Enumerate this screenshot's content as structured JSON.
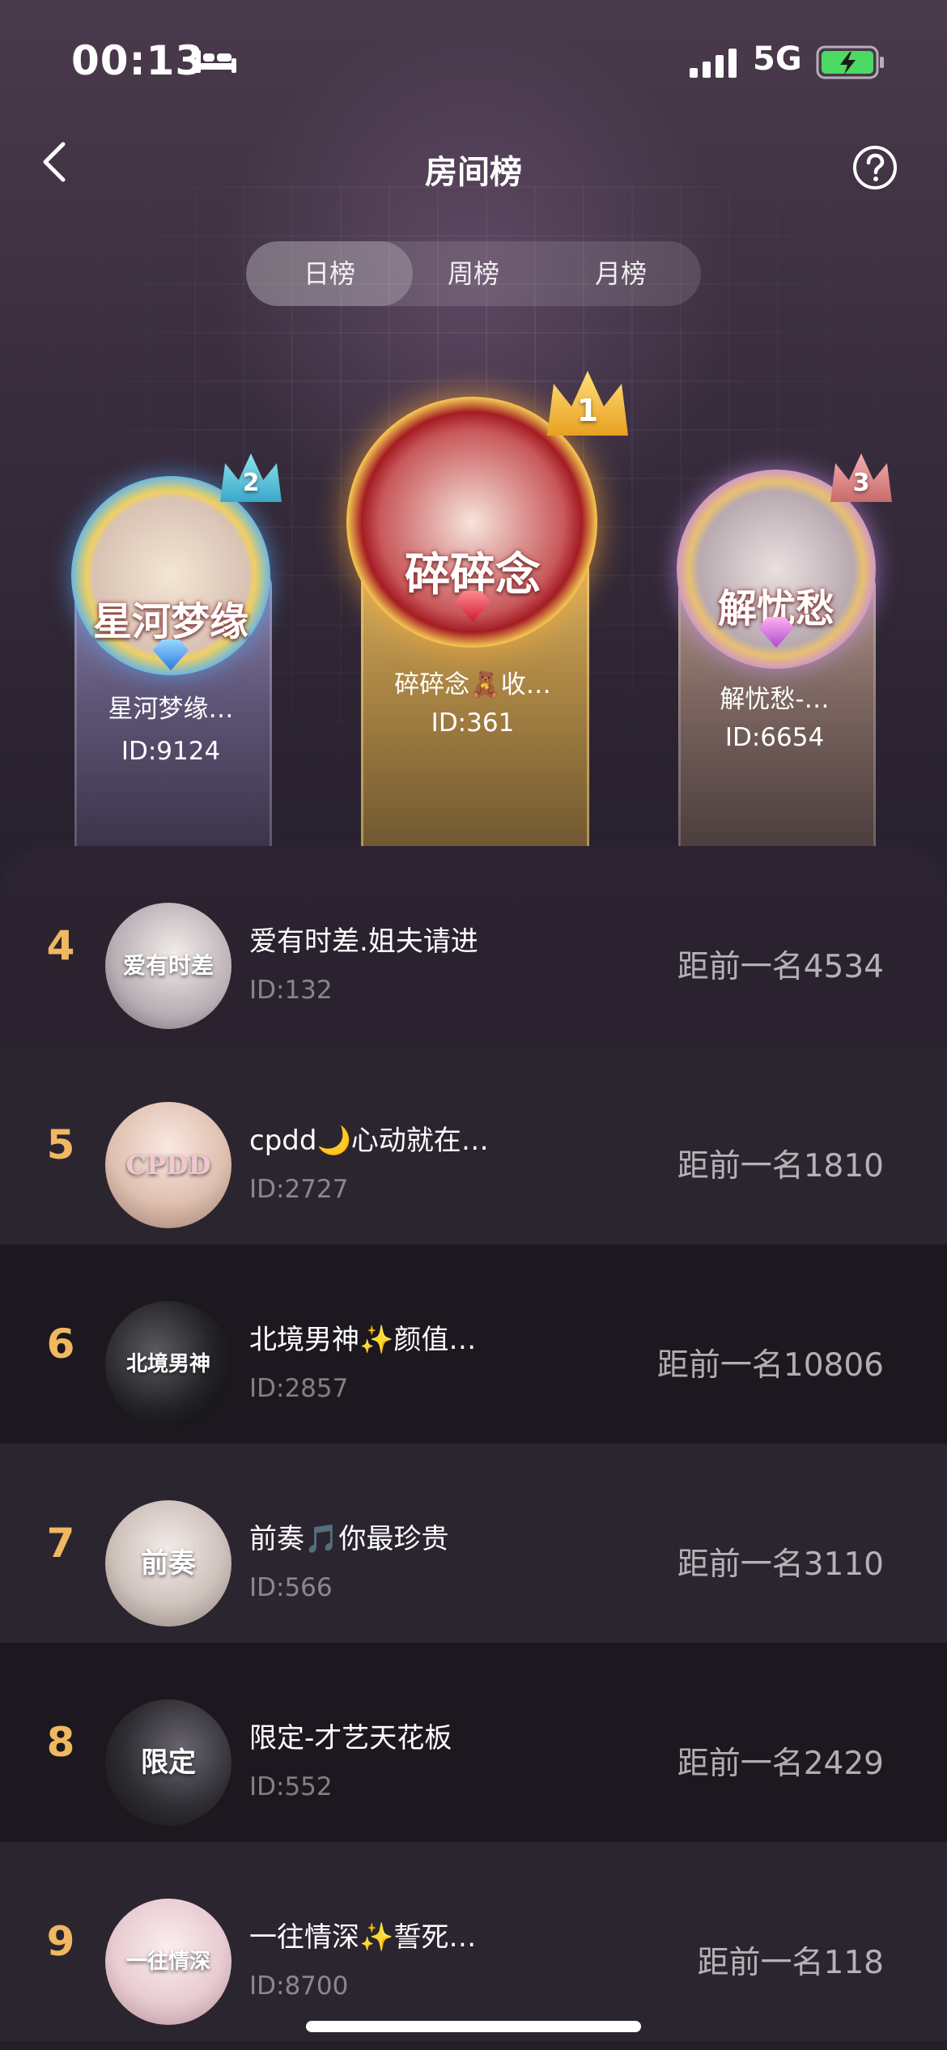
{
  "status_bar": {
    "time": "00:13",
    "network": "5G",
    "icons": [
      "sleep-mode-icon",
      "signal-icon",
      "battery-charging-icon"
    ]
  },
  "header": {
    "title": "房间榜",
    "back_icon": "chevron-left-icon",
    "help_icon": "question-circle-icon"
  },
  "tabs": [
    {
      "label": "日榜",
      "active": true
    },
    {
      "label": "周榜",
      "active": false
    },
    {
      "label": "月榜",
      "active": false
    }
  ],
  "podium": [
    {
      "rank": "1",
      "frame_text": "碎碎念",
      "name": "碎碎念🧸收…",
      "id": "ID:361"
    },
    {
      "rank": "2",
      "frame_text": "星河梦缘",
      "name": "星河梦缘…",
      "id": "ID:9124"
    },
    {
      "rank": "3",
      "frame_text": "解忧愁",
      "name": "解忧愁-…",
      "id": "ID:6654"
    }
  ],
  "list": [
    {
      "rank": "4",
      "avatar_text": "爱有时差",
      "name": "爱有时差.姐夫请进",
      "id": "ID:132",
      "gap": "距前一名4534",
      "avatar_color": "#d8d0d4"
    },
    {
      "rank": "5",
      "avatar_text": "CPDD",
      "name": "cpdd🌙心动就在…",
      "id": "ID:2727",
      "gap": "距前一名1810",
      "avatar_color": "#ead6cc"
    },
    {
      "rank": "6",
      "avatar_text": "北境男神",
      "name": "北境男神✨颜值…",
      "id": "ID:2857",
      "gap": "距前一名10806",
      "avatar_color": "#1e1e22"
    },
    {
      "rank": "7",
      "avatar_text": "前奏",
      "name": "前奏🎵你最珍贵",
      "id": "ID:566",
      "gap": "距前一名3110",
      "avatar_color": "#d6ccc6"
    },
    {
      "rank": "8",
      "avatar_text": "限定",
      "name": "限定-才艺天花板",
      "id": "ID:552",
      "gap": "距前一名2429",
      "avatar_color": "#2a282c"
    },
    {
      "rank": "9",
      "avatar_text": "一往情深",
      "name": "一往情深✨誓死…",
      "id": "ID:8700",
      "gap": "距前一名118",
      "avatar_color": "#f0d8dc"
    }
  ],
  "colors": {
    "rank_number": "#f0b860",
    "gold": "#e8c46c",
    "silver": "#8e84b0",
    "bronze": "#b59a8e"
  }
}
